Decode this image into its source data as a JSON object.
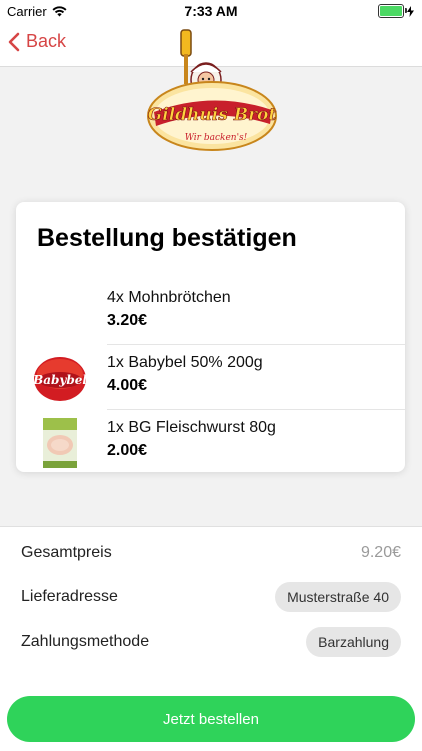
{
  "status_bar": {
    "carrier": "Carrier",
    "time": "7:33 AM"
  },
  "nav": {
    "back_label": "Back"
  },
  "logo": {
    "brand": "Gildhuis Brot",
    "tagline": "Wir backen's!"
  },
  "card": {
    "title": "Bestellung bestätigen",
    "items": [
      {
        "name": "4x Mohnbrötchen",
        "price": "3.20€",
        "image": "none"
      },
      {
        "name": "1x Babybel 50% 200g",
        "price": "4.00€",
        "image": "babybel-icon",
        "image_text": "Babybel"
      },
      {
        "name": "1x BG Fleischwurst 80g",
        "price": "2.00€",
        "image": "fleischwurst-package-icon"
      }
    ]
  },
  "summary": {
    "total_label": "Gesamtpreis",
    "total_value": "9.20€",
    "address_label": "Lieferadresse",
    "address_value": "Musterstraße 40",
    "payment_label": "Zahlungsmethode",
    "payment_value": "Barzahlung"
  },
  "order_button": "Jetzt bestellen",
  "colors": {
    "accent_red": "#d64545",
    "order_green": "#2fd35a",
    "battery_green": "#4cd964"
  }
}
